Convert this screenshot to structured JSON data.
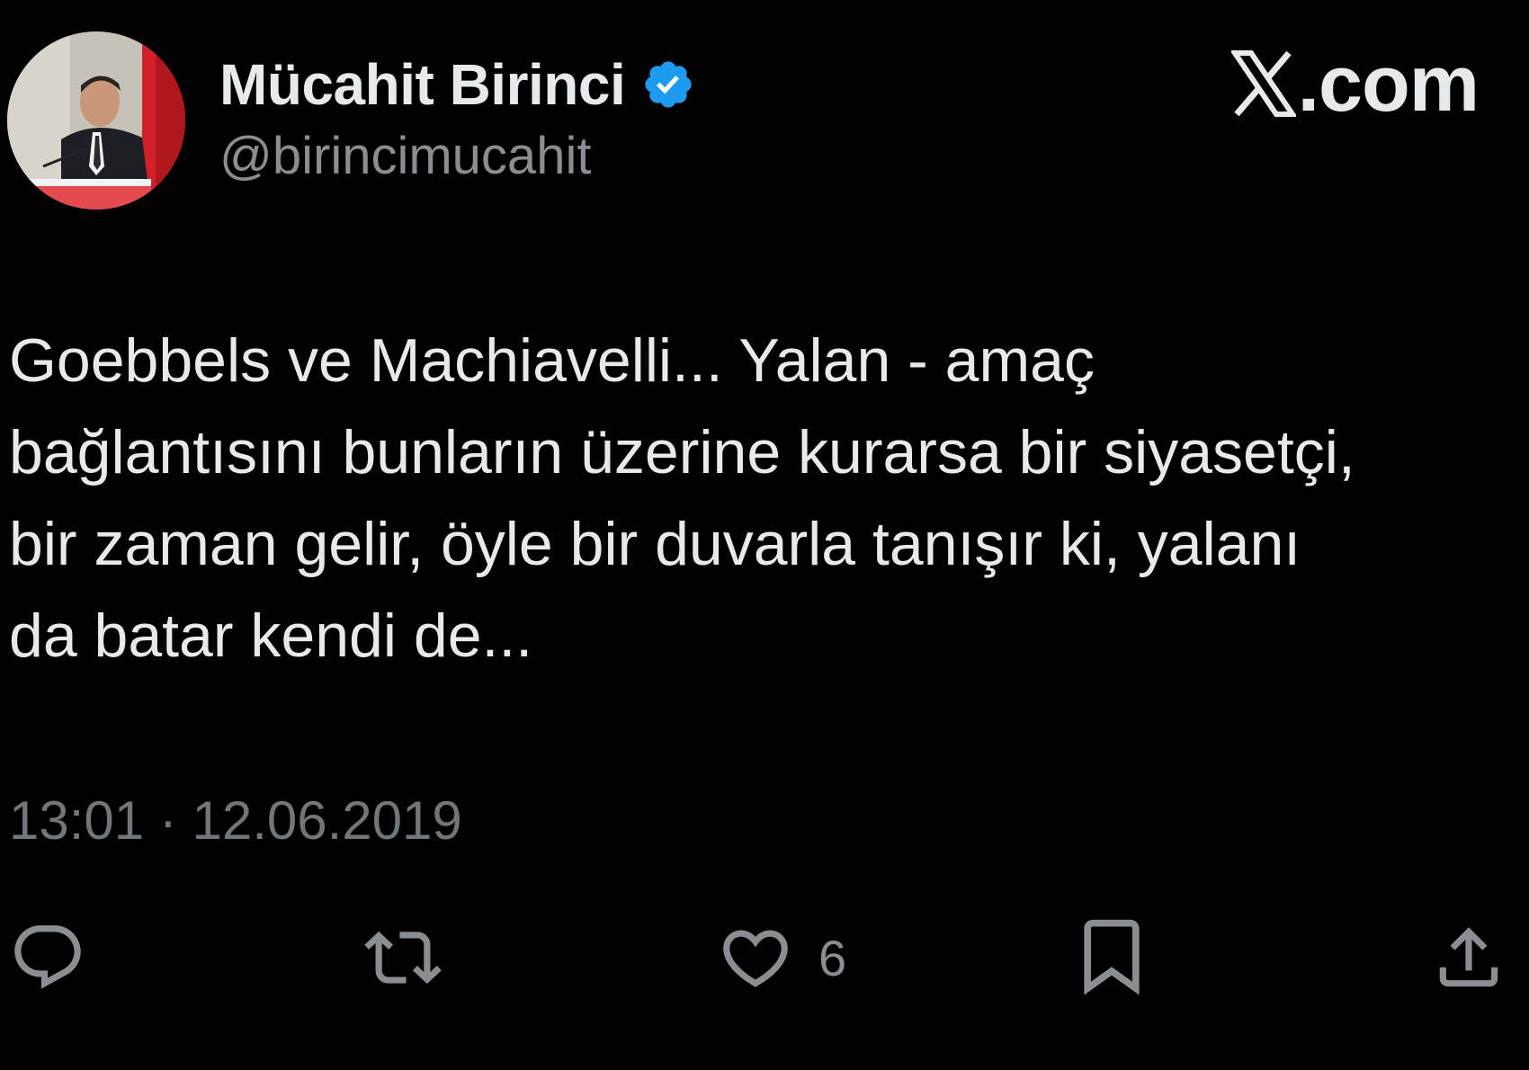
{
  "author": {
    "display_name": "Mücahit Birinci",
    "handle": "@birincimucahit",
    "verified": true,
    "verified_color": "#1d9bf0"
  },
  "brand": {
    "text": ".com",
    "icon": "x-logo-icon"
  },
  "tweet": {
    "text": "Goebbels ve Machiavelli... Yalan - amaç\nbağlantısını bunların üzerine kurarsa bir siyasetçi,\nbir zaman gelir, öyle bir duvarla tanışır ki, yalanı\nda batar kendi de...",
    "timestamp": "13:01 · 12.06.2019"
  },
  "actions": {
    "reply": {
      "icon": "reply-icon"
    },
    "retweet": {
      "icon": "retweet-icon"
    },
    "like": {
      "icon": "heart-icon",
      "count": "6"
    },
    "bookmark": {
      "icon": "bookmark-icon"
    },
    "share": {
      "icon": "share-icon"
    }
  },
  "colors": {
    "background": "#000000",
    "primary_text": "#e7e9ea",
    "secondary_text": "#71767b"
  }
}
